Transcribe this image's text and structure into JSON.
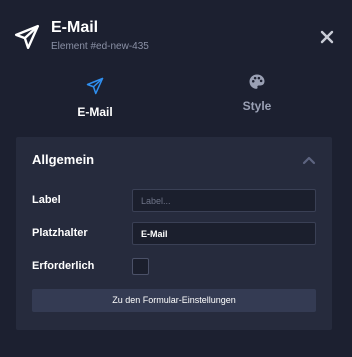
{
  "header": {
    "title": "E-Mail",
    "subtitle": "Element #ed-new-435",
    "icon": "paper-plane-icon"
  },
  "tabs": [
    {
      "label": "E-Mail",
      "icon": "paper-plane-icon",
      "active": true
    },
    {
      "label": "Style",
      "icon": "palette-icon",
      "active": false
    }
  ],
  "section": {
    "title": "Allgemein",
    "fields": {
      "label": {
        "label": "Label",
        "placeholder": "Label...",
        "value": ""
      },
      "placeholder": {
        "label": "Platzhalter",
        "value": "E-Mail"
      },
      "required": {
        "label": "Erforderlich",
        "checked": false
      }
    },
    "button_label": "Zu den Formular-Einstellungen"
  },
  "colors": {
    "background": "#1c2030",
    "panel": "#262b3d",
    "accent": "#2f8ff0",
    "muted_text": "#8b91a6"
  }
}
